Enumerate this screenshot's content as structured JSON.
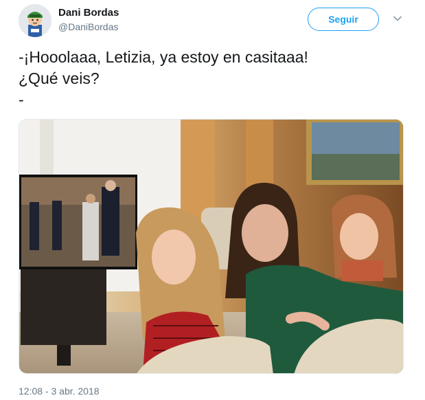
{
  "user": {
    "display_name": "Dani Bordas",
    "handle": "@DaniBordas",
    "avatar_icon": "playmobil-avatar-icon"
  },
  "actions": {
    "follow_label": "Seguir",
    "more_icon": "chevron-down-icon"
  },
  "tweet": {
    "lines": [
      "-¡Hooolaaa, Letizia, ya estoy en casitaaa!",
      "¿Qué veis?",
      "-"
    ]
  },
  "meta": {
    "timestamp": "12:08 - 3 abr. 2018"
  },
  "colors": {
    "accent": "#1da1f2",
    "text": "#14171a",
    "secondary": "#657786"
  }
}
